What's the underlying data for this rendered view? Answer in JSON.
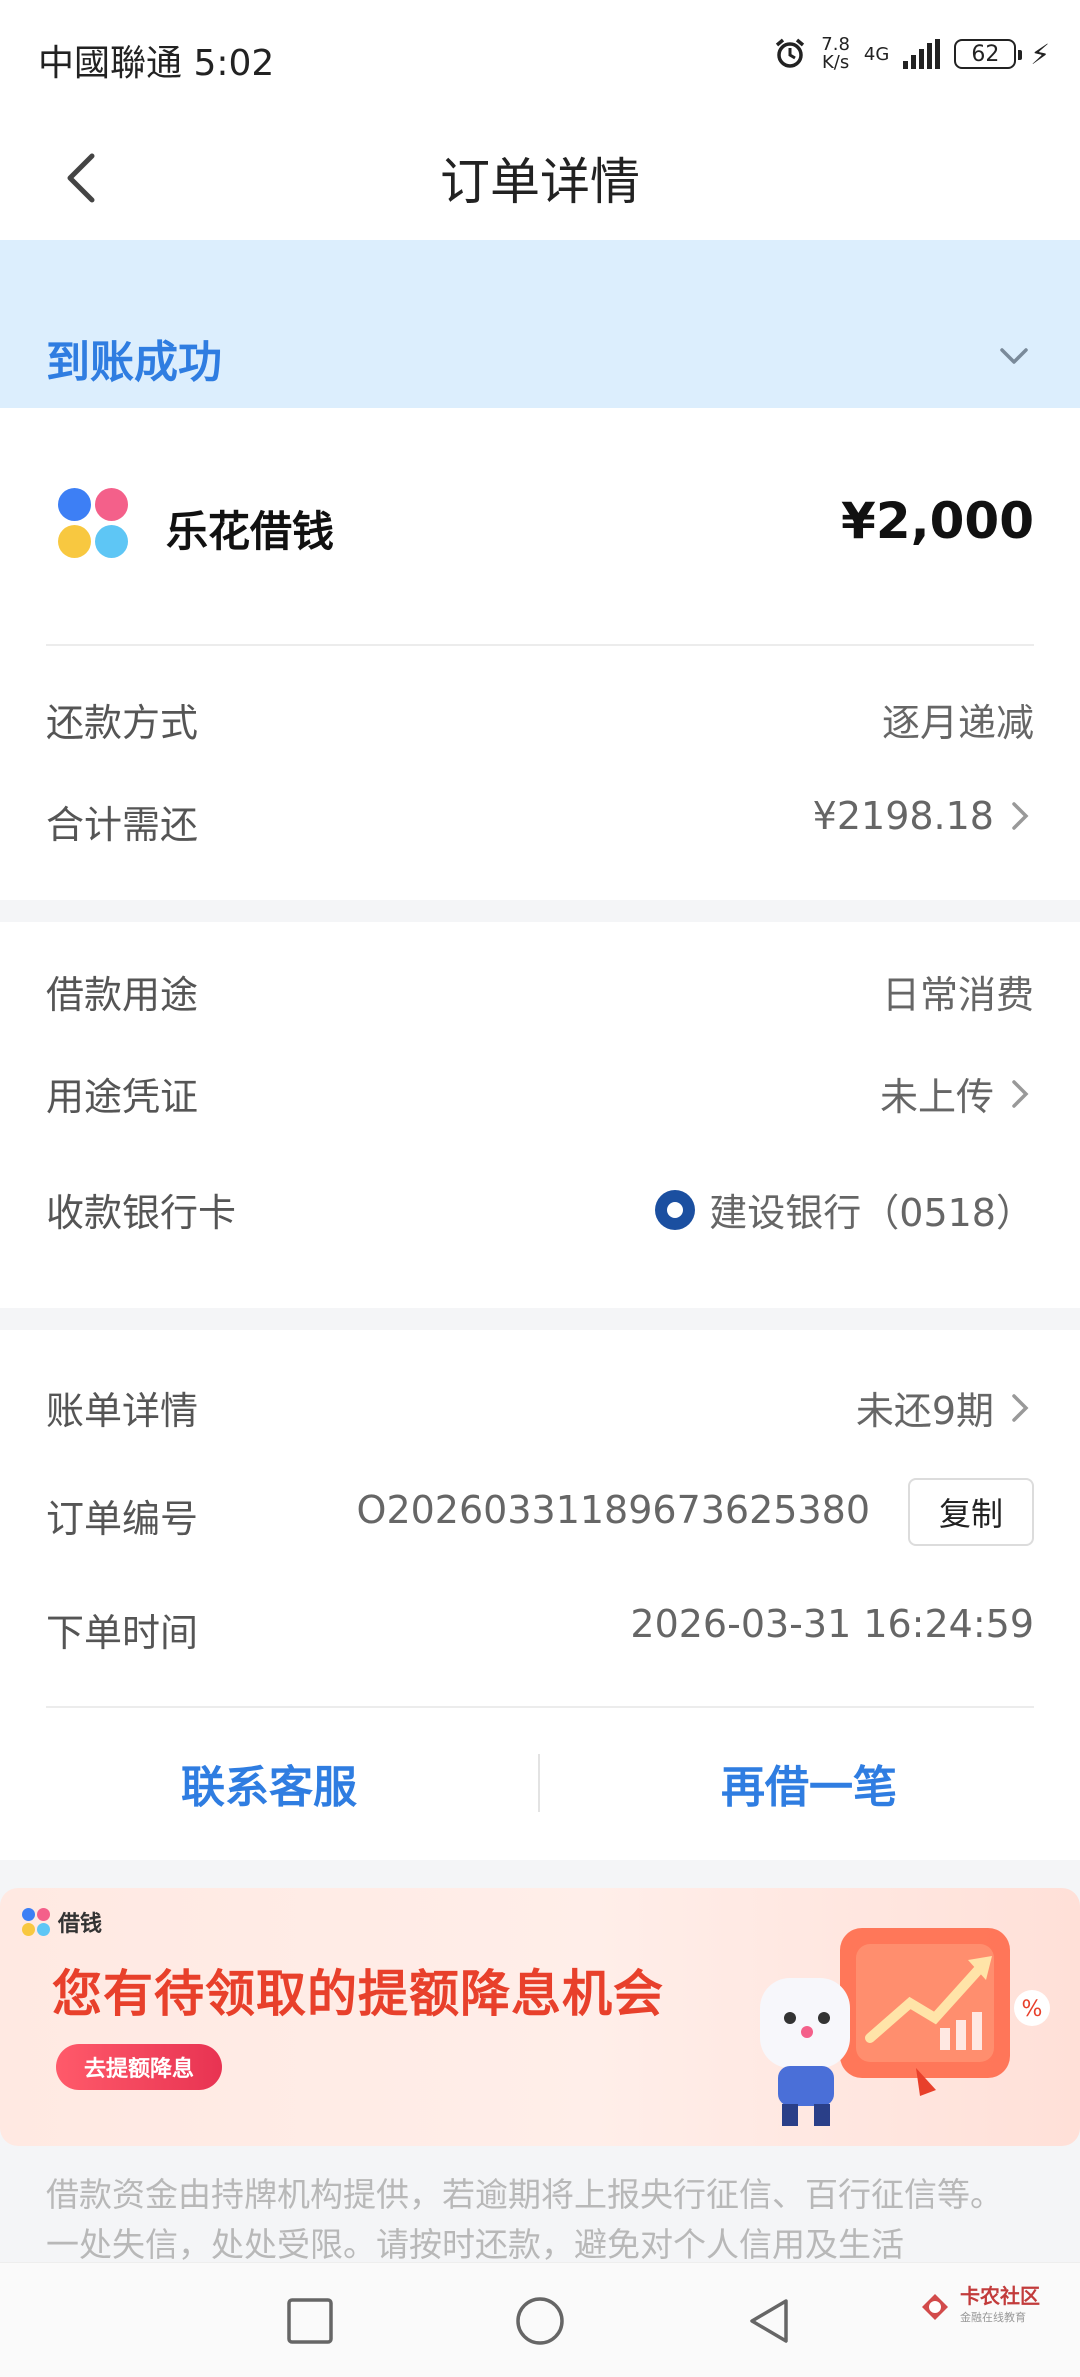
{
  "status_bar": {
    "carrier_time": "中國聯通 5:02",
    "speed_value": "7.8",
    "speed_unit": "K/s",
    "network": "4G",
    "battery": "62"
  },
  "nav": {
    "title": "订单详情"
  },
  "banner": {
    "status": "到账成功"
  },
  "loan": {
    "name": "乐花借钱",
    "amount": "¥2,000"
  },
  "repayment": {
    "method_label": "还款方式",
    "method_value": "逐月递减",
    "total_label": "合计需还",
    "total_value": "¥2198.18"
  },
  "purpose": {
    "purpose_label": "借款用途",
    "purpose_value": "日常消费",
    "proof_label": "用途凭证",
    "proof_value": "未上传",
    "card_label": "收款银行卡",
    "card_value": "建设银行（0518）"
  },
  "order": {
    "bill_label": "账单详情",
    "bill_value": "未还9期",
    "order_no_label": "订单编号",
    "order_no_value": "O20260331189673625380",
    "copy_label": "复制",
    "time_label": "下单时间",
    "time_value": "2026-03-31 16:24:59"
  },
  "actions": {
    "contact": "联系客服",
    "borrow_again": "再借一笔"
  },
  "promo": {
    "brand": "借钱",
    "title": "您有待领取的提额降息机会",
    "button": "去提额降息"
  },
  "disclaimer": "借款资金由持牌机构提供，若逾期将上报央行征信、百行征信等。一处失信，处处受限。请按时还款，避免对个人信用及生活",
  "watermark": {
    "title": "卡农社区",
    "sub": "金融在线教育"
  },
  "colors": {
    "accent": "#2f7de1",
    "banner_bg": "#dceefd",
    "promo_red": "#e8402b"
  }
}
